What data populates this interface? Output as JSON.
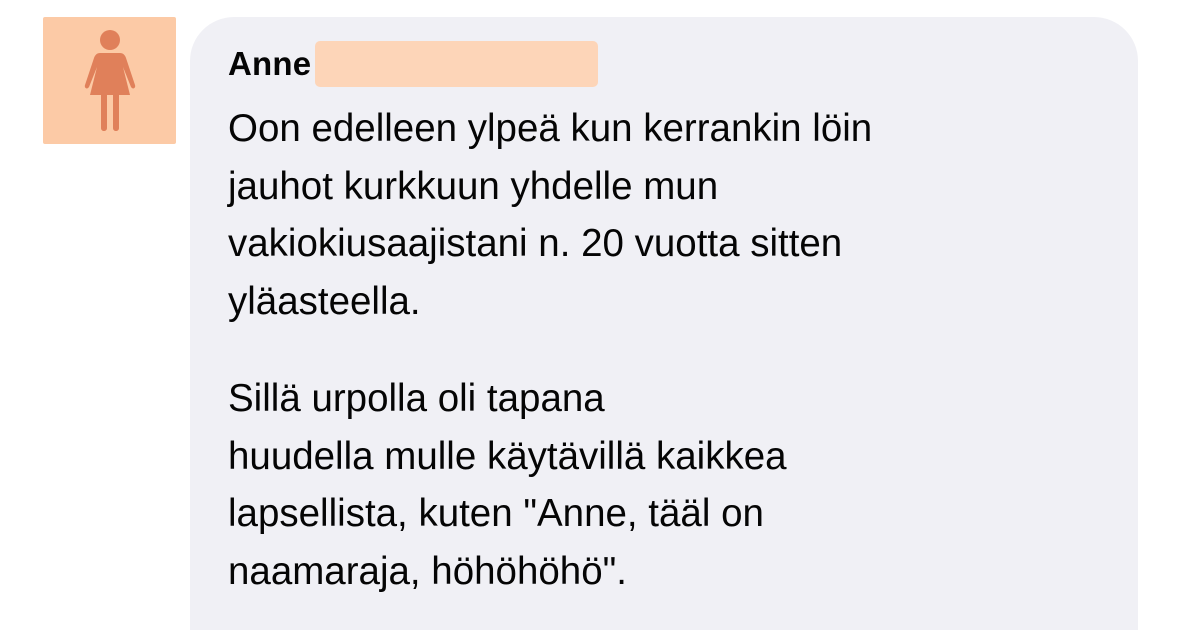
{
  "avatar": {
    "icon": "female-person-icon",
    "background": "#fccaa6",
    "figure_color": "#e0805a"
  },
  "comment": {
    "author": "Anne",
    "paragraphs": [
      "Oon edelleen ylpeä kun kerrankin löin\njauhot kurkkuun yhdelle mun\nvakiokiusaajistani n. 20 vuotta sitten\nyläasteella.",
      "Sillä urpolla oli tapana\nhuudella mulle käytävillä kaikkea\nlapsellista, kuten \"Anne, tääl on\nnaamaraja, höhöhöhö\"."
    ]
  },
  "colors": {
    "bubble": "#f0f0f5",
    "redaction": "#fdd5b8",
    "text": "#050505"
  }
}
